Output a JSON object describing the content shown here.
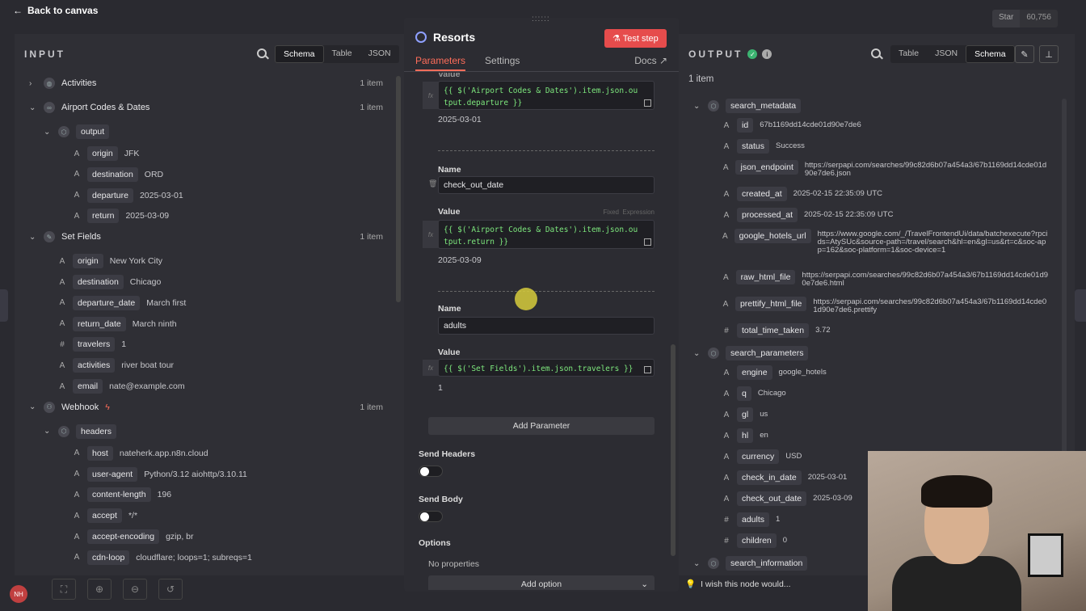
{
  "topbar": {
    "back": "Back to canvas",
    "star": "Star",
    "star_count": "60,756"
  },
  "input": {
    "title": "INPUT",
    "view_tabs": [
      "Schema",
      "Table",
      "JSON"
    ],
    "rows": [
      {
        "kind": "node",
        "name": "Activities",
        "count": "1 item",
        "chev": "›",
        "icon": "globe-icon"
      },
      {
        "kind": "node",
        "name": "Airport Codes & Dates",
        "count": "1 item",
        "chev": "⌄",
        "icon": "link-icon"
      },
      {
        "kind": "obj",
        "key": "output",
        "chev": "⌄",
        "icon": "cube-icon"
      },
      {
        "kind": "field",
        "key": "origin",
        "val": "JFK",
        "type": "A"
      },
      {
        "kind": "field",
        "key": "destination",
        "val": "ORD",
        "type": "A"
      },
      {
        "kind": "field",
        "key": "departure",
        "val": "2025-03-01",
        "type": "A"
      },
      {
        "kind": "field",
        "key": "return",
        "val": "2025-03-09",
        "type": "A"
      },
      {
        "kind": "node",
        "name": "Set Fields",
        "count": "1 item",
        "chev": "⌄",
        "icon": "pencil-icon"
      },
      {
        "kind": "field2",
        "key": "origin",
        "val": "New York City",
        "type": "A"
      },
      {
        "kind": "field2",
        "key": "destination",
        "val": "Chicago",
        "type": "A"
      },
      {
        "kind": "field2",
        "key": "departure_date",
        "val": "March first",
        "type": "A"
      },
      {
        "kind": "field2",
        "key": "return_date",
        "val": "March ninth",
        "type": "A"
      },
      {
        "kind": "field2",
        "key": "travelers",
        "val": "1",
        "type": "#"
      },
      {
        "kind": "field2",
        "key": "activities",
        "val": "river boat tour",
        "type": "A"
      },
      {
        "kind": "field2",
        "key": "email",
        "val": "nate@example.com",
        "type": "A"
      },
      {
        "kind": "node",
        "name": "Webhook",
        "count": "1 item",
        "chev": "⌄",
        "icon": "webhook-icon",
        "bolt": "ϟ"
      },
      {
        "kind": "obj",
        "key": "headers",
        "chev": "⌄",
        "icon": "cube-icon"
      },
      {
        "kind": "field",
        "key": "host",
        "val": "nateherk.app.n8n.cloud",
        "type": "A"
      },
      {
        "kind": "field",
        "key": "user-agent",
        "val": "Python/3.12 aiohttp/3.10.11",
        "type": "A"
      },
      {
        "kind": "field",
        "key": "content-length",
        "val": "196",
        "type": "A"
      },
      {
        "kind": "field",
        "key": "accept",
        "val": "*/*",
        "type": "A"
      },
      {
        "kind": "field",
        "key": "accept-encoding",
        "val": "gzip, br",
        "type": "A"
      },
      {
        "kind": "field",
        "key": "cdn-loop",
        "val": "cloudflare; loops=1; subreqs=1",
        "type": "A"
      }
    ]
  },
  "node": {
    "title": "Resorts",
    "test_step": "Test step",
    "tabs": [
      "Parameters",
      "Settings"
    ],
    "docs": "Docs",
    "value_label": "Value",
    "name_label": "Name",
    "fixed": "Fixed",
    "expression": "Expression",
    "fx": "fx",
    "p1_expr": "{{ $('Airport Codes & Dates').item.json.output.departure }}",
    "p1_preview": "2025-03-01",
    "p2_name": "check_out_date",
    "p2_expr": "{{ $('Airport Codes & Dates').item.json.output.return }}",
    "p2_preview": "2025-03-09",
    "p3_name": "adults",
    "p3_expr": "{{ $('Set Fields').item.json.travelers }}",
    "p3_preview": "1",
    "add_parameter": "Add Parameter",
    "send_headers": "Send Headers",
    "send_body": "Send Body",
    "options": "Options",
    "no_properties": "No properties",
    "add_option": "Add option"
  },
  "output": {
    "title": "OUTPUT",
    "view_tabs": [
      "Table",
      "JSON",
      "Schema"
    ],
    "count": "1 item",
    "rows": [
      {
        "kind": "obj",
        "key": "search_metadata"
      },
      {
        "kind": "field",
        "key": "id",
        "val": "67b1169dd14cde01d90e7de6",
        "type": "A"
      },
      {
        "kind": "field",
        "key": "status",
        "val": "Success",
        "type": "A"
      },
      {
        "kind": "field",
        "key": "json_endpoint",
        "val": "https://serpapi.com/searches/99c82d6b07a454a3/67b1169dd14cde01d90e7de6.json",
        "type": "A",
        "h": 2
      },
      {
        "kind": "field",
        "key": "created_at",
        "val": "2025-02-15 22:35:09 UTC",
        "type": "A"
      },
      {
        "kind": "field",
        "key": "processed_at",
        "val": "2025-02-15 22:35:09 UTC",
        "type": "A"
      },
      {
        "kind": "field",
        "key": "google_hotels_url",
        "val": "https://www.google.com/_/TravelFrontendUi/data/batchexecute?rpcids=AtySUc&source-path=/travel/search&hl=en&gl=us&rt=c&soc-app=162&soc-platform=1&soc-device=1",
        "type": "A",
        "h": 3
      },
      {
        "kind": "field",
        "key": "raw_html_file",
        "val": "https://serpapi.com/searches/99c82d6b07a454a3/67b1169dd14cde01d90e7de6.html",
        "type": "A",
        "h": 2
      },
      {
        "kind": "field",
        "key": "prettify_html_file",
        "val": "https://serpapi.com/searches/99c82d6b07a454a3/67b1169dd14cde01d90e7de6.prettify",
        "type": "A",
        "h": 2
      },
      {
        "kind": "field",
        "key": "total_time_taken",
        "val": "3.72",
        "type": "#"
      },
      {
        "kind": "obj",
        "key": "search_parameters"
      },
      {
        "kind": "field",
        "key": "engine",
        "val": "google_hotels",
        "type": "A"
      },
      {
        "kind": "field",
        "key": "q",
        "val": "Chicago",
        "type": "A"
      },
      {
        "kind": "field",
        "key": "gl",
        "val": "us",
        "type": "A"
      },
      {
        "kind": "field",
        "key": "hl",
        "val": "en",
        "type": "A"
      },
      {
        "kind": "field",
        "key": "currency",
        "val": "USD",
        "type": "A"
      },
      {
        "kind": "field",
        "key": "check_in_date",
        "val": "2025-03-01",
        "type": "A"
      },
      {
        "kind": "field",
        "key": "check_out_date",
        "val": "2025-03-09",
        "type": "A"
      },
      {
        "kind": "field",
        "key": "adults",
        "val": "1",
        "type": "#"
      },
      {
        "kind": "field",
        "key": "children",
        "val": "0",
        "type": "#"
      },
      {
        "kind": "obj",
        "key": "search_information"
      }
    ]
  },
  "toast": "I wish this node would...",
  "avatar": "NH"
}
